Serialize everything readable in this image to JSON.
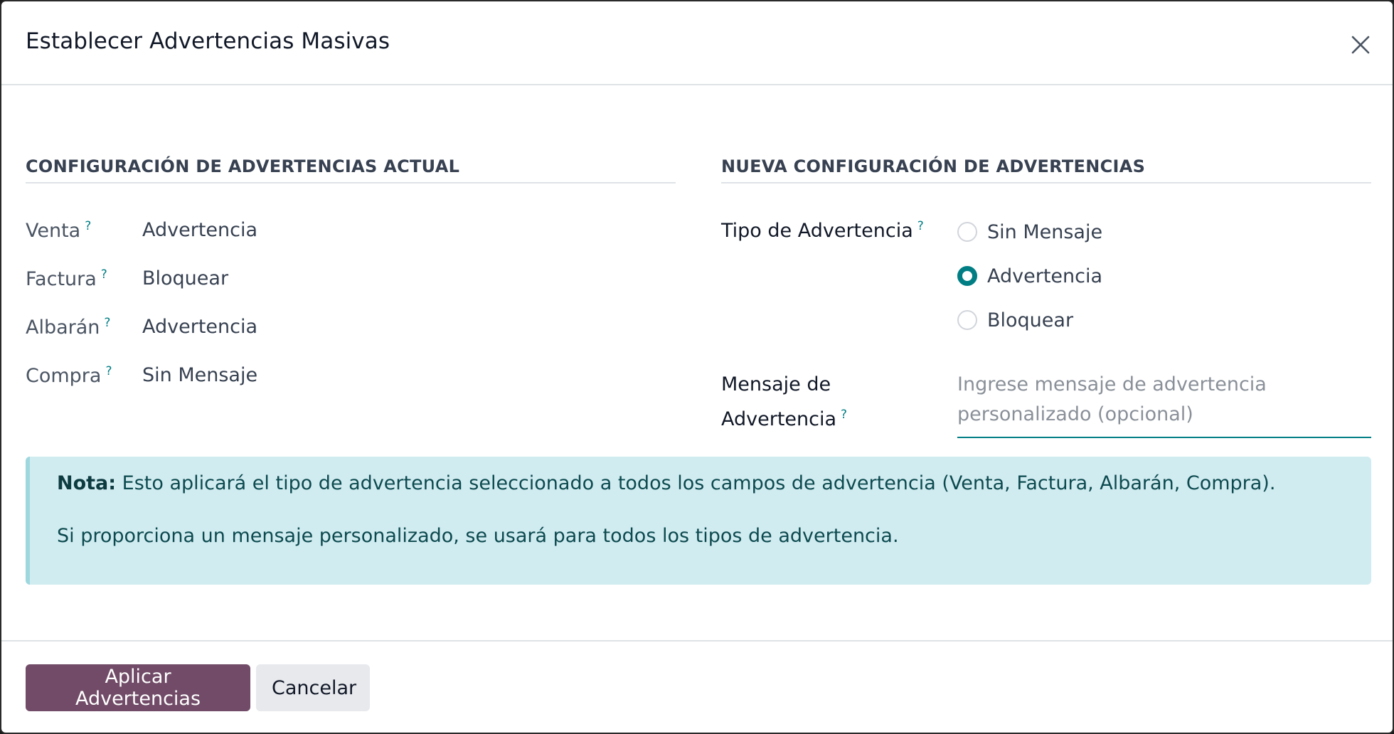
{
  "dialog": {
    "title": "Establecer Advertencias Masivas",
    "close_icon": "close-icon"
  },
  "current": {
    "heading": "CONFIGURACIÓN DE ADVERTENCIAS ACTUAL",
    "rows": [
      {
        "label": "Venta",
        "value": "Advertencia"
      },
      {
        "label": "Factura",
        "value": "Bloquear"
      },
      {
        "label": "Albarán",
        "value": "Advertencia"
      },
      {
        "label": "Compra",
        "value": "Sin Mensaje"
      }
    ],
    "help_mark": "?"
  },
  "new_config": {
    "heading": "NUEVA CONFIGURACIÓN DE ADVERTENCIAS",
    "type_label": "Tipo de Advertencia",
    "options": [
      {
        "label": "Sin Mensaje",
        "checked": false
      },
      {
        "label": "Advertencia",
        "checked": true
      },
      {
        "label": "Bloquear",
        "checked": false
      }
    ],
    "message_label_1": "Mensaje de",
    "message_label_2": "Advertencia",
    "message_value": "",
    "message_placeholder": "Ingrese mensaje de advertencia personalizado (opcional)"
  },
  "note": {
    "strong": "Nota:",
    "line1": " Esto aplicará el tipo de advertencia seleccionado a todos los campos de advertencia (Venta, Factura, Albarán, Compra).",
    "line2": "Si proporciona un mensaje personalizado, se usará para todos los tipos de advertencia."
  },
  "footer": {
    "apply_label": "Aplicar Advertencias",
    "cancel_label": "Cancelar"
  },
  "colors": {
    "primary": "#714b67",
    "accent": "#017e84",
    "note_bg": "#d1ecf1"
  }
}
